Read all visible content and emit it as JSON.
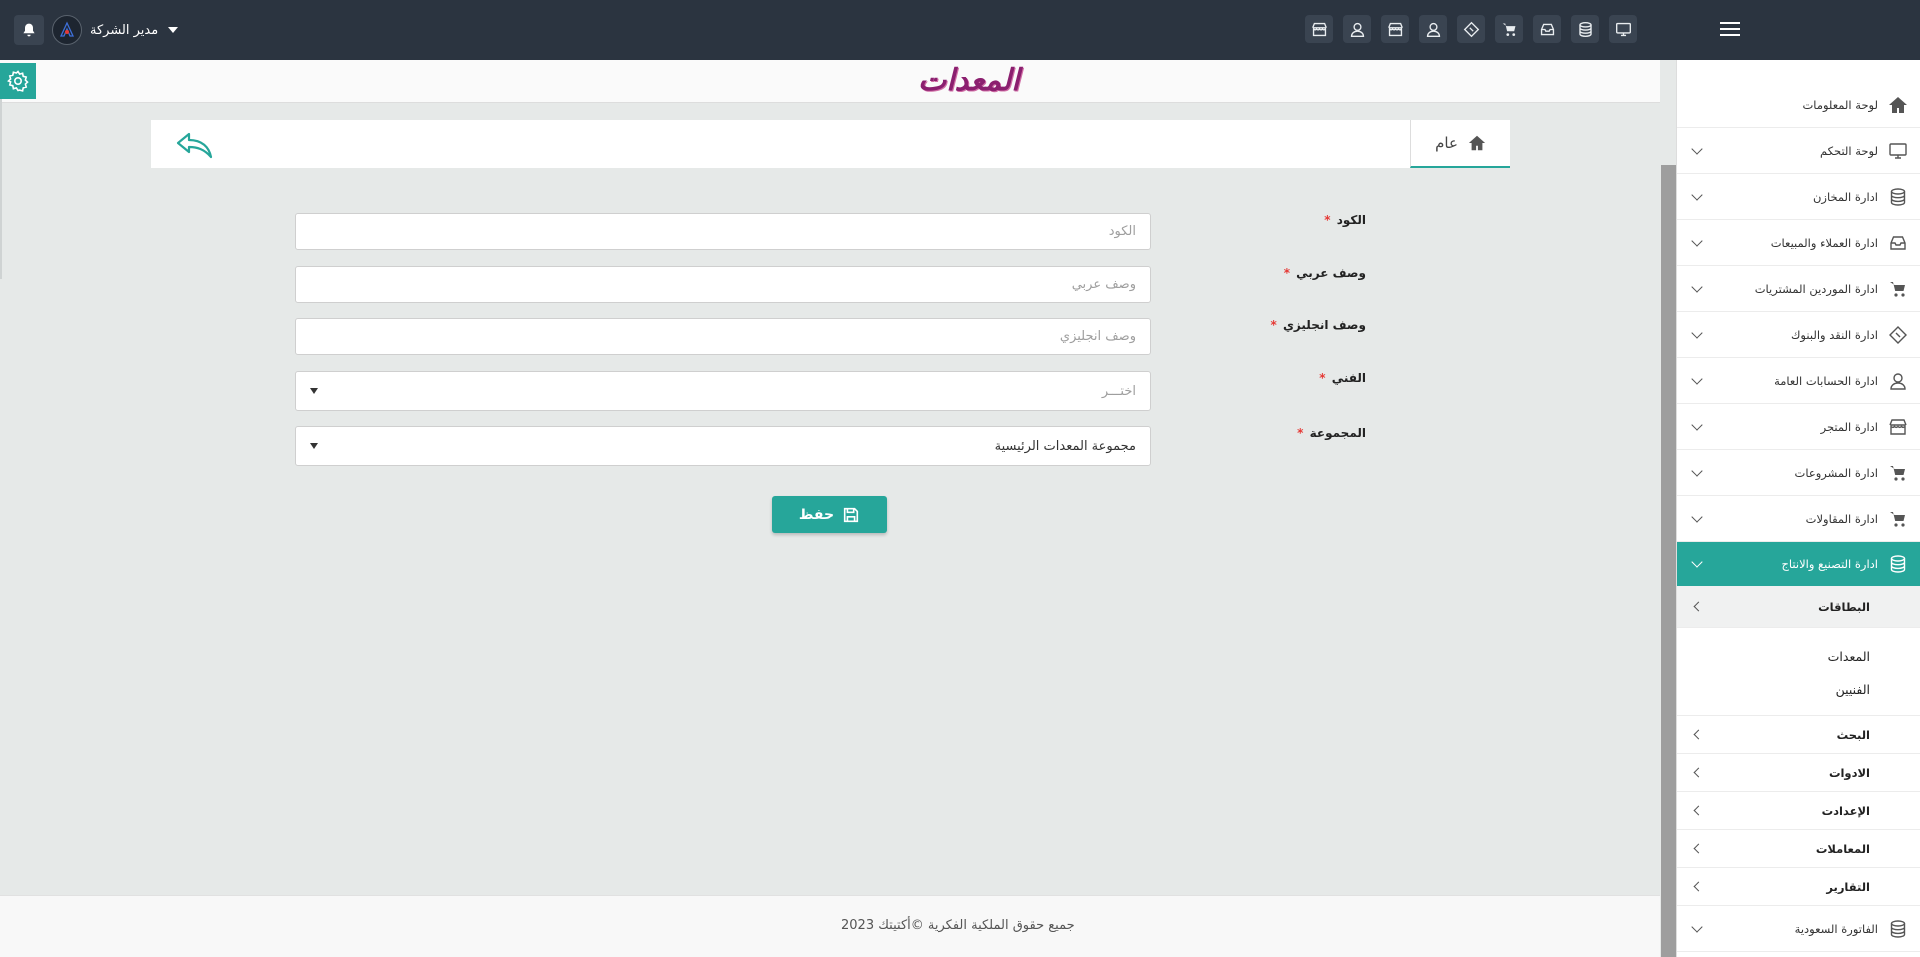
{
  "header": {
    "user_name": "مدير الشركة"
  },
  "page": {
    "title": "المعدات"
  },
  "tabs": {
    "general": "عام"
  },
  "form": {
    "code": {
      "label": "الكود",
      "required": "*",
      "placeholder": "الكود",
      "value": ""
    },
    "arabic_desc": {
      "label": "وصف عربي",
      "required": "*",
      "placeholder": "وصف عربي",
      "value": ""
    },
    "english_desc": {
      "label": "وصف انجليزي",
      "required": "*",
      "placeholder": "وصف انجليزي",
      "value": ""
    },
    "technician": {
      "label": "الفني",
      "required": "*",
      "selected": "اختـــر"
    },
    "group": {
      "label": "المجموعة",
      "required": "*",
      "selected": "مجموعة المعدات الرئيسية"
    },
    "save_label": "حفظ"
  },
  "sidebar": {
    "items": [
      {
        "label": "لوحة المعلومات",
        "icon": "home-icon"
      },
      {
        "label": "لوحة التحكم",
        "icon": "monitor-icon"
      },
      {
        "label": "ادارة المخازن",
        "icon": "database-icon"
      },
      {
        "label": "ادارة العملاء والمبيعات",
        "icon": "inbox-icon"
      },
      {
        "label": "ادارة الموردين المشتريات",
        "icon": "cart-icon"
      },
      {
        "label": "ادارة النقد والبنوك",
        "icon": "ticket-icon"
      },
      {
        "label": "ادارة الحسابات العامة",
        "icon": "user-icon"
      },
      {
        "label": "ادارة المتجر",
        "icon": "store-icon"
      },
      {
        "label": "ادارة المشروعات",
        "icon": "cart-icon"
      },
      {
        "label": "ادارة المقاولات",
        "icon": "cart-icon"
      },
      {
        "label": "ادارة التصنيع والانتاج",
        "icon": "database-icon"
      }
    ],
    "sub_open": "البطاقات",
    "leaves": [
      "المعدات",
      "الفنيين"
    ],
    "sub_items": [
      "البحث",
      "الادوات",
      "الإعدادت",
      "المعاملات",
      "التقارير"
    ],
    "last_item": {
      "label": "الفاتورة السعودية",
      "icon": "database-icon"
    }
  },
  "footer": {
    "text": "جميع حقوق الملكية الفكرية ©أكتيتك 2023"
  },
  "colors": {
    "topbar": "#2b3440",
    "accent": "#26a69a",
    "title": "#8b1f6f"
  }
}
